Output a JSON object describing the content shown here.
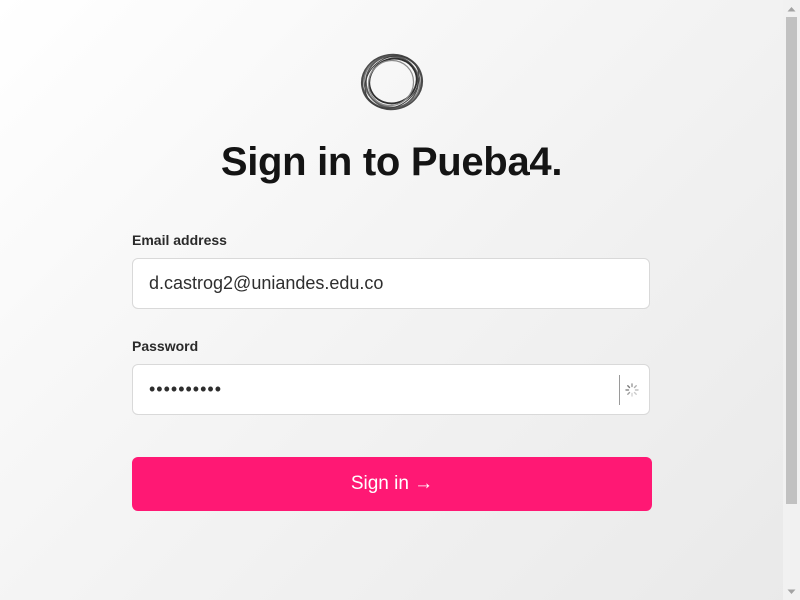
{
  "app": {
    "title": "Sign in to Pueba4."
  },
  "form": {
    "email_label": "Email address",
    "email_value": "d.castrog2@uniandes.edu.co",
    "password_label": "Password",
    "password_value": "••••••••••",
    "submit_label": "Sign in →"
  },
  "icons": {
    "logo": "ring-logo-icon",
    "password_manager": "spinner-icon",
    "scroll_up": "scroll-up-arrow-icon",
    "scroll_down": "scroll-down-arrow-icon"
  },
  "colors": {
    "accent": "#ff1874",
    "title": "#141414",
    "field_border": "#d9d9d9"
  }
}
